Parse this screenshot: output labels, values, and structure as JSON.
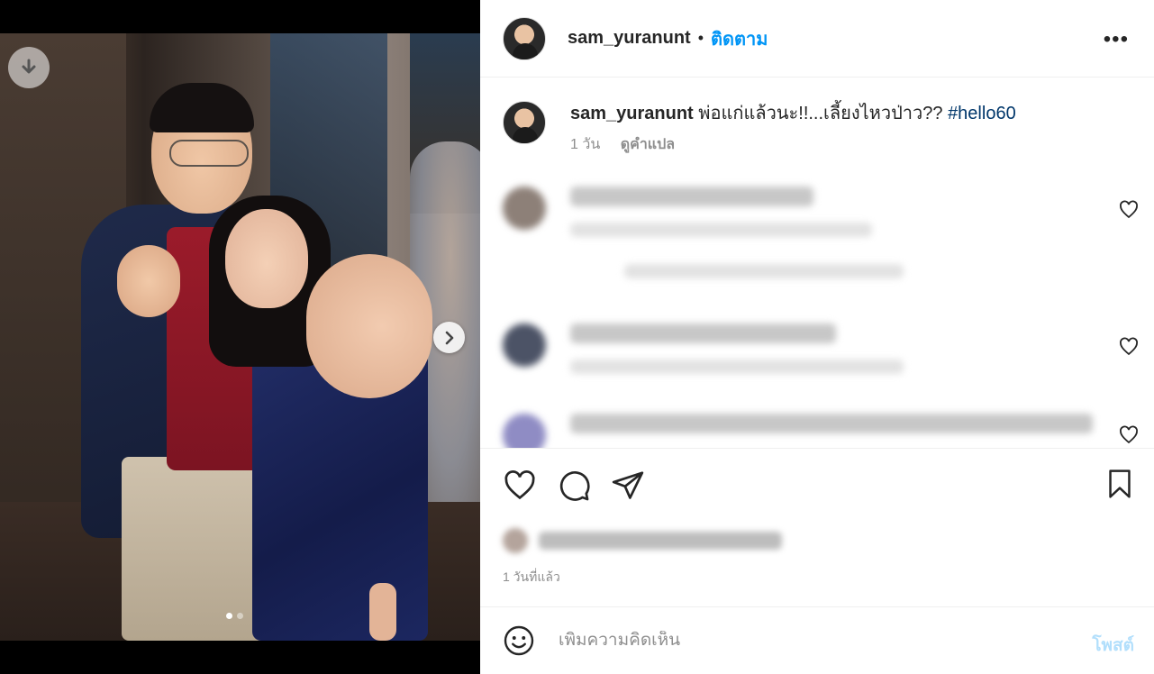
{
  "post": {
    "username": "sam_yuranunt",
    "separator": "•",
    "follow_label": "ติดตาม",
    "more_icon": "more-options-icon",
    "media": {
      "current_slide": 1,
      "total_slides": 2
    }
  },
  "caption": {
    "username": "sam_yuranunt",
    "text": " พ่อแก่แล้วนะ!!...เลี้ยงไหวป่าว?? ",
    "hashtag": "#hello60",
    "age": "1 วัน",
    "translate_label": "ดูคำแปล"
  },
  "footer": {
    "time_ago": "1 วันที่แล้ว",
    "comment_placeholder": "เพิ่มความคิดเห็น",
    "post_label": "โพสต์"
  },
  "colors": {
    "accent": "#0095f6",
    "hashtag": "#00376b",
    "post_disabled": "#b2dffc",
    "muted": "#8e8e8e"
  }
}
